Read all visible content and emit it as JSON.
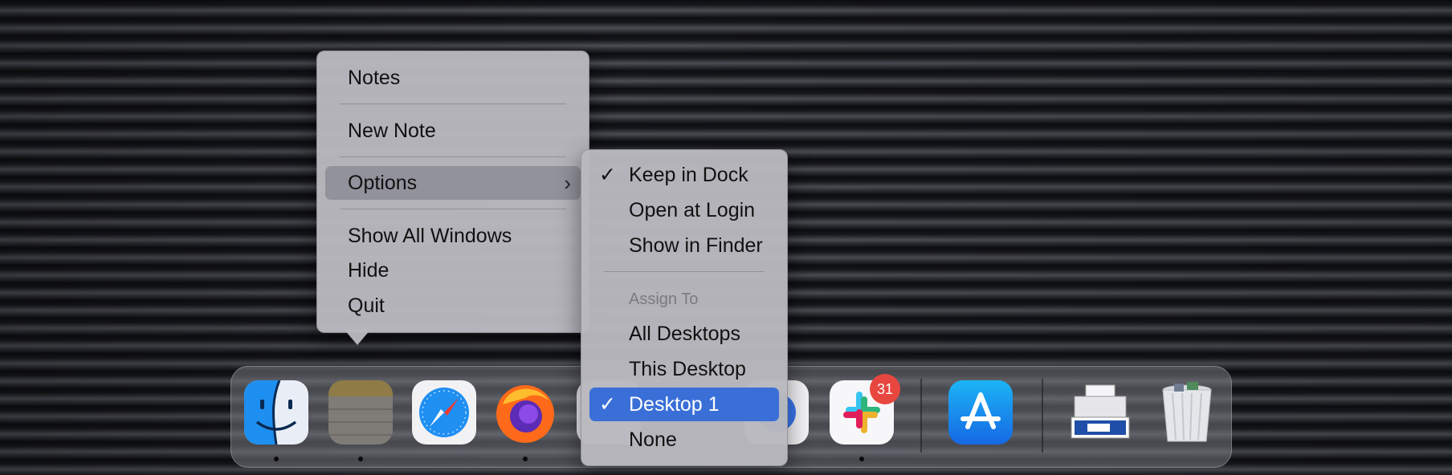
{
  "main_menu": {
    "items": [
      {
        "label": "Notes"
      },
      {
        "label": "New Note"
      },
      {
        "label": "Options"
      },
      {
        "label": "Show All Windows"
      },
      {
        "label": "Hide"
      },
      {
        "label": "Quit"
      }
    ],
    "highlighted": "Options"
  },
  "options_menu": {
    "items": [
      {
        "label": "Keep in Dock",
        "checked": true
      },
      {
        "label": "Open at Login",
        "checked": false
      },
      {
        "label": "Show in Finder",
        "checked": false
      }
    ],
    "assign_to": {
      "heading": "Assign To",
      "items": [
        {
          "label": "All Desktops",
          "checked": false
        },
        {
          "label": "This Desktop",
          "checked": false
        },
        {
          "label": "Desktop 1",
          "checked": true
        },
        {
          "label": "None",
          "checked": false
        }
      ]
    },
    "check_glyph": "✓",
    "submenu_glyph": "›"
  },
  "dock": {
    "apps": [
      {
        "name": "Finder",
        "icon": "finder-icon",
        "running": true
      },
      {
        "name": "Notes",
        "icon": "notes-icon",
        "running": true
      },
      {
        "name": "Safari",
        "icon": "safari-icon",
        "running": false
      },
      {
        "name": "Firefox",
        "icon": "firefox-icon",
        "running": true
      },
      {
        "name": "Hidden app",
        "icon": "partially-hidden-app-icon",
        "running": false
      },
      {
        "name": "Signal",
        "icon": "signal-icon",
        "running": false
      },
      {
        "name": "Slack",
        "icon": "slack-icon",
        "running": true,
        "badge": "31"
      },
      {
        "name": "App Store",
        "icon": "app-store-icon",
        "running": false
      },
      {
        "name": "Downloads",
        "icon": "downloads-stack-icon",
        "running": false
      },
      {
        "name": "Trash",
        "icon": "trash-icon",
        "running": false
      }
    ]
  },
  "colors": {
    "selection": "#3a6fd8",
    "badge": "#e8473f",
    "menu_bg": "#b8b8be"
  }
}
